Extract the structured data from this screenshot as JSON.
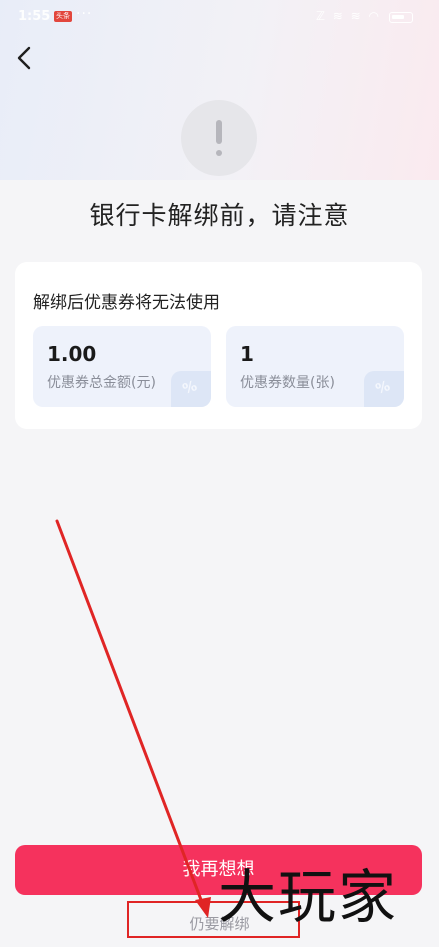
{
  "status_bar": {
    "time": "1:55",
    "badge": "头条",
    "dots": "···",
    "icons": "ℤ ≋ ≋ ◠"
  },
  "header": {
    "back_icon": "chevron-left-icon"
  },
  "warning": {
    "icon": "exclamation-icon"
  },
  "page_title": "银行卡解绑前，请注意",
  "coupon_card": {
    "heading": "解绑后优惠券将无法使用",
    "stats": [
      {
        "value": "1.00",
        "label": "优惠券总金额(元)"
      },
      {
        "value": "1",
        "label": "优惠券数量(张)"
      }
    ],
    "ticket_glyph": "%"
  },
  "actions": {
    "reconsider_label": "我再想想",
    "unbind_label": "仍要解绑"
  },
  "watermark": "大玩家",
  "colors": {
    "primary": "#f5325d",
    "annotation": "#e02525"
  }
}
